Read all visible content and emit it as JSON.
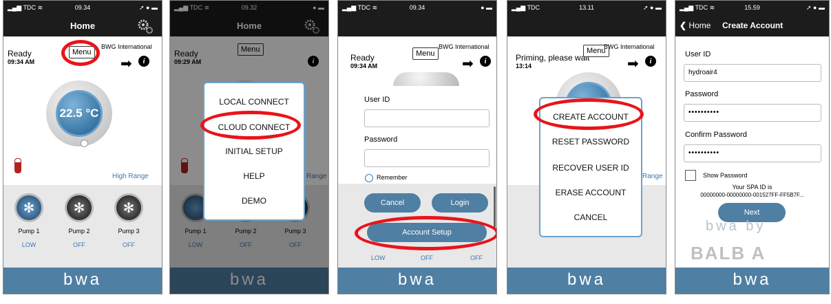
{
  "screens": [
    {
      "status": {
        "carrier": "TDC",
        "time": "09.34"
      },
      "nav_title": "Home",
      "state": "Ready",
      "clock": "09:34 AM",
      "menu": "Menu",
      "brand": "BWG International",
      "temperature": "22.5 °C",
      "range": "High Range",
      "pumps": [
        {
          "name": "Pump 1",
          "state": "LOW"
        },
        {
          "name": "Pump 2",
          "state": "OFF"
        },
        {
          "name": "Pump 3",
          "state": "OFF"
        }
      ],
      "footer": "bwa"
    },
    {
      "status": {
        "carrier": "TDC",
        "time": "09.32"
      },
      "nav_title": "Home",
      "state": "Ready",
      "clock": "09:29 AM",
      "menu": "Menu",
      "range": "Range",
      "menu_items": [
        "LOCAL CONNECT",
        "CLOUD CONNECT",
        "INITIAL SETUP",
        "HELP",
        "DEMO"
      ],
      "pumps": [
        {
          "name": "Pump 1",
          "state": "LOW"
        },
        {
          "name": "Pump 2",
          "state": "OFF"
        },
        {
          "name": "Pump 3",
          "state": "OFF"
        }
      ],
      "footer": "bwa"
    },
    {
      "status": {
        "carrier": "TDC",
        "time": "09.34"
      },
      "state": "Ready",
      "clock": "09:34 AM",
      "menu": "Menu",
      "brand": "BWG International",
      "user_id_label": "User ID",
      "password_label": "Password",
      "remember": "Remember",
      "cancel": "Cancel",
      "login": "Login",
      "account_setup": "Account Setup",
      "pump_states": [
        "LOW",
        "OFF",
        "OFF"
      ],
      "footer": "bwa"
    },
    {
      "status": {
        "carrier": "TDC",
        "time": "13.11"
      },
      "state": "Priming, please wait",
      "clock": "13:14",
      "menu": "Menu",
      "brand": "BWG International",
      "range": "Range",
      "menu_items": [
        "CREATE ACCOUNT",
        "RESET PASSWORD",
        "RECOVER USER ID",
        "ERASE ACCOUNT",
        "CANCEL"
      ],
      "footer": "bwa"
    },
    {
      "status": {
        "carrier": "TDC",
        "time": "15.59"
      },
      "back": "Home",
      "nav_title": "Create Account",
      "user_id_label": "User ID",
      "user_id_value": "hydroair4",
      "password_label": "Password",
      "password_value": "••••••••••",
      "confirm_label": "Confirm Password",
      "confirm_value": "••••••••••",
      "show_password": "Show Password",
      "spa_id_line1": "Your SPA ID is",
      "spa_id_line2": "00000000-00000000-001527FF-FF5B7F...",
      "next": "Next",
      "bwa_by": "bwa by",
      "balboa": "BALB A",
      "footer": "bwa"
    }
  ],
  "icons": [
    "gear-icon",
    "arrow-right-icon",
    "info-icon",
    "thermometer-icon",
    "pump-icon",
    "back-chevron-icon"
  ],
  "colors": {
    "accent": "#4f7fa3",
    "highlight_ring": "#e8141a",
    "range_text": "#3a78b5"
  }
}
